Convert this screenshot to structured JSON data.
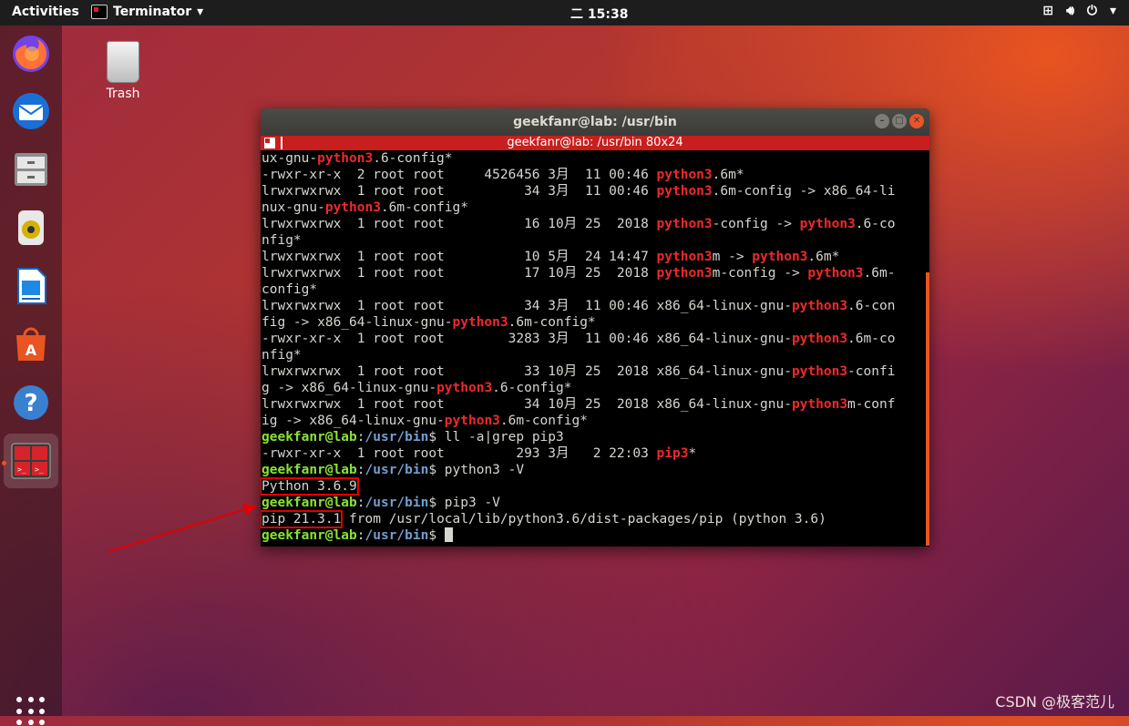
{
  "topbar": {
    "activities": "Activities",
    "app_name": "Terminator",
    "clock": "二 15:38"
  },
  "desktop": {
    "trash_label": "Trash"
  },
  "window": {
    "title": "geekfanr@lab: /usr/bin",
    "tab_title": "geekfanr@lab: /usr/bin 80x24"
  },
  "terminal_lines": [
    [
      [
        "ux-gnu-",
        ""
      ],
      [
        "python3",
        "py"
      ],
      [
        ".6-config*",
        ""
      ]
    ],
    [
      [
        "-rwxr-xr-x  2 root root     4526456 3月  11 00:46 ",
        ""
      ],
      [
        "python3",
        "py"
      ],
      [
        ".6m*",
        "pyw"
      ]
    ],
    [
      [
        "lrwxrwxrwx  1 root root          34 3月  11 00:46 ",
        ""
      ],
      [
        "python3",
        "py"
      ],
      [
        ".6m-config -> x86_64-li",
        ""
      ]
    ],
    [
      [
        "nux-gnu-",
        ""
      ],
      [
        "python3",
        "py"
      ],
      [
        ".6m-config*",
        ""
      ]
    ],
    [
      [
        "lrwxrwxrwx  1 root root          16 10月 25  2018 ",
        ""
      ],
      [
        "python3",
        "py"
      ],
      [
        "-config -> ",
        ""
      ],
      [
        "python3",
        "py"
      ],
      [
        ".6-co",
        ""
      ]
    ],
    [
      [
        "nfig*",
        ""
      ]
    ],
    [
      [
        "lrwxrwxrwx  1 root root          10 5月  24 14:47 ",
        ""
      ],
      [
        "python3",
        "py"
      ],
      [
        "m -> ",
        ""
      ],
      [
        "python3",
        "py"
      ],
      [
        ".6m*",
        ""
      ]
    ],
    [
      [
        "lrwxrwxrwx  1 root root          17 10月 25  2018 ",
        ""
      ],
      [
        "python3",
        "py"
      ],
      [
        "m-config -> ",
        ""
      ],
      [
        "python3",
        "py"
      ],
      [
        ".6m-",
        ""
      ]
    ],
    [
      [
        "config*",
        ""
      ]
    ],
    [
      [
        "lrwxrwxrwx  1 root root          34 3月  11 00:46 x86_64-linux-gnu-",
        ""
      ],
      [
        "python3",
        "py"
      ],
      [
        ".6-con",
        ""
      ]
    ],
    [
      [
        "fig -> x86_64-linux-gnu-",
        ""
      ],
      [
        "python3",
        "py"
      ],
      [
        ".6m-config*",
        ""
      ]
    ],
    [
      [
        "-rwxr-xr-x  1 root root        3283 3月  11 00:46 x86_64-linux-gnu-",
        ""
      ],
      [
        "python3",
        "py"
      ],
      [
        ".6m-co",
        ""
      ]
    ],
    [
      [
        "nfig*",
        ""
      ]
    ],
    [
      [
        "lrwxrwxrwx  1 root root          33 10月 25  2018 x86_64-linux-gnu-",
        ""
      ],
      [
        "python3",
        "py"
      ],
      [
        "-confi",
        ""
      ]
    ],
    [
      [
        "g -> x86_64-linux-gnu-",
        ""
      ],
      [
        "python3",
        "py"
      ],
      [
        ".6-config*",
        ""
      ]
    ],
    [
      [
        "lrwxrwxrwx  1 root root          34 10月 25  2018 x86_64-linux-gnu-",
        ""
      ],
      [
        "python3",
        "py"
      ],
      [
        "m-conf",
        ""
      ]
    ],
    [
      [
        "ig -> x86_64-linux-gnu-",
        ""
      ],
      [
        "python3",
        "py"
      ],
      [
        ".6m-config*",
        ""
      ]
    ],
    [
      [
        "geekfanr@lab",
        "pg"
      ],
      [
        ":",
        ""
      ],
      [
        "/usr/bin",
        "pb"
      ],
      [
        "$ ll -a|grep pip3",
        ""
      ]
    ],
    [
      [
        "-rwxr-xr-x  1 root root         293 3月   2 22:03 ",
        ""
      ],
      [
        "pip3",
        "py"
      ],
      [
        "*",
        ""
      ]
    ],
    [
      [
        "geekfanr@lab",
        "pg"
      ],
      [
        ":",
        ""
      ],
      [
        "/usr/bin",
        "pb"
      ],
      [
        "$ python3 -V",
        ""
      ]
    ],
    [
      [
        "Python 3.6.9",
        "hl"
      ]
    ],
    [
      [
        "geekfanr@lab",
        "pg"
      ],
      [
        ":",
        ""
      ],
      [
        "/usr/bin",
        "pb"
      ],
      [
        "$ pip3 -V",
        ""
      ]
    ],
    [
      [
        "pip 21.3.1",
        "hl"
      ],
      [
        " from /usr/local/lib/python3.6/dist-packages/pip (python 3.6)",
        ""
      ]
    ],
    [
      [
        "geekfanr@lab",
        "pg"
      ],
      [
        ":",
        ""
      ],
      [
        "/usr/bin",
        "pb"
      ],
      [
        "$ ",
        ""
      ]
    ]
  ],
  "watermark": "CSDN @极客范儿"
}
